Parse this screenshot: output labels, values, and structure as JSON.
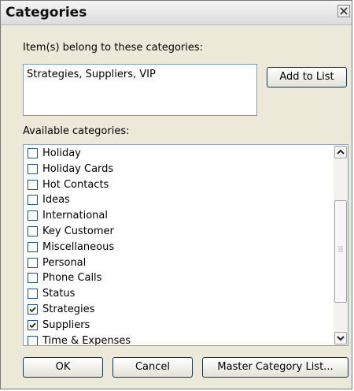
{
  "dialog": {
    "title": "Categories"
  },
  "item_categories": {
    "label": "Item(s) belong to these categories:",
    "value": "Strategies, Suppliers, VIP",
    "add_button": "Add to List"
  },
  "available": {
    "label": "Available categories:",
    "items": [
      {
        "label": "Holiday",
        "checked": false
      },
      {
        "label": "Holiday Cards",
        "checked": false
      },
      {
        "label": "Hot Contacts",
        "checked": false
      },
      {
        "label": "Ideas",
        "checked": false
      },
      {
        "label": "International",
        "checked": false
      },
      {
        "label": "Key Customer",
        "checked": false
      },
      {
        "label": "Miscellaneous",
        "checked": false
      },
      {
        "label": "Personal",
        "checked": false
      },
      {
        "label": "Phone Calls",
        "checked": false
      },
      {
        "label": "Status",
        "checked": false
      },
      {
        "label": "Strategies",
        "checked": true
      },
      {
        "label": "Suppliers",
        "checked": true
      },
      {
        "label": "Time & Expenses",
        "checked": false
      }
    ]
  },
  "buttons": {
    "ok": "OK",
    "cancel": "Cancel",
    "master": "Master Category List..."
  },
  "icons": {
    "close": "close-icon",
    "scroll_up": "scroll-up-arrow-icon",
    "scroll_down": "scroll-down-arrow-icon",
    "check": "checkmark-icon"
  }
}
